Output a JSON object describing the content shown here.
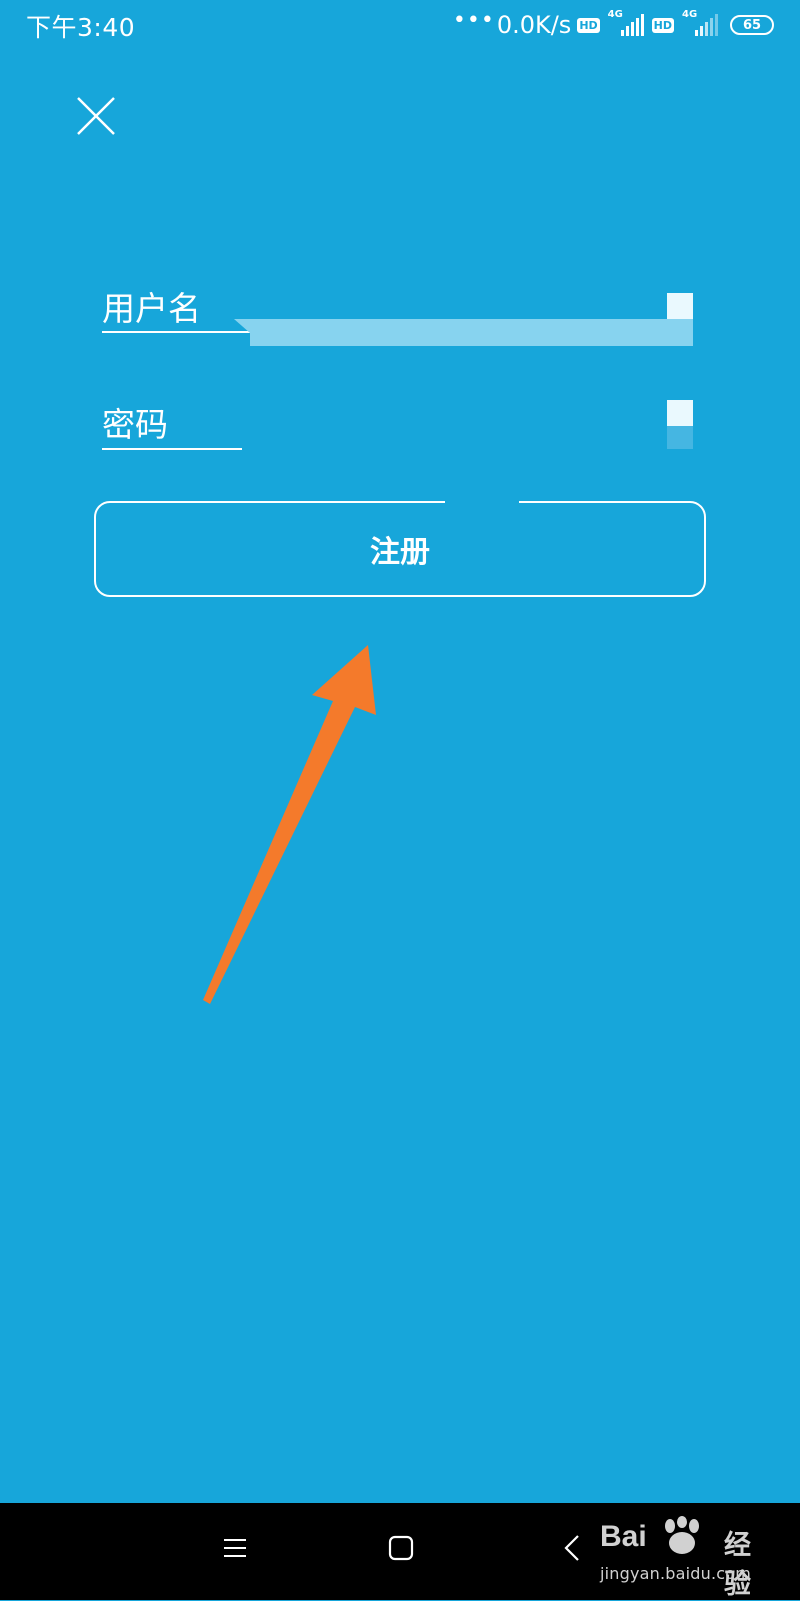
{
  "status_bar": {
    "time": "下午3:40",
    "dots": "•••",
    "net_speed": "0.0K/s",
    "hd_label": "HD",
    "network_type": "4G",
    "battery": "65"
  },
  "form": {
    "username_label": "用户名",
    "password_label": "密码",
    "register_label": "注册"
  },
  "icons": {
    "close": "close-icon",
    "annotation": "arrow-annotation",
    "nav_menu": "menu-icon",
    "nav_home": "home-icon",
    "nav_back": "back-icon"
  },
  "colors": {
    "background": "#17a6da",
    "accent_arrow": "#f47a2b",
    "nav_bar": "#000000"
  },
  "watermark": {
    "brand_left": "Bai",
    "brand_right": "经验",
    "url": "jingyan.baidu.com"
  }
}
